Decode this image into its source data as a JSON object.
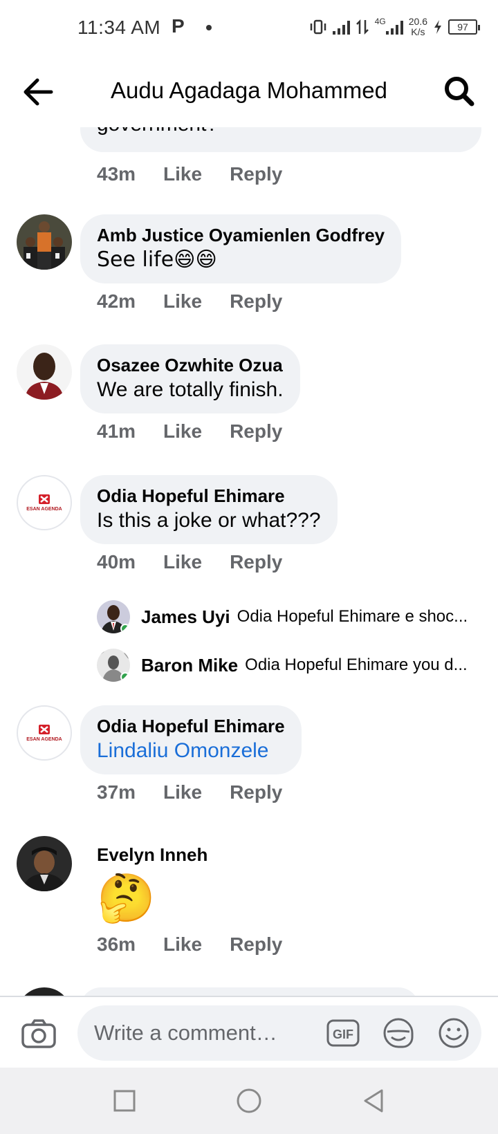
{
  "status_bar": {
    "time": "11:34 AM",
    "app_indicator": "P",
    "network_type": "4G",
    "net_speed_value": "20.6",
    "net_speed_unit": "K/s",
    "battery": "97"
  },
  "header": {
    "title": "Audu Agadaga Mohammed",
    "back_icon": "arrow-left-icon",
    "search_icon": "search-icon"
  },
  "comments": [
    {
      "text": "government?",
      "time": "43m",
      "like_label": "Like",
      "reply_label": "Reply"
    },
    {
      "author": "Amb Justice Oyamienlen Godfrey",
      "text": "See life😄😄",
      "time": "42m",
      "like_label": "Like",
      "reply_label": "Reply"
    },
    {
      "author": "Osazee Ozwhite Ozua",
      "text": "We are totally finish.",
      "time": "41m",
      "like_label": "Like",
      "reply_label": "Reply"
    },
    {
      "author": "Odia Hopeful Ehimare",
      "avatar_text": "ESAN AGENDA",
      "text": "Is this a joke or what???",
      "time": "40m",
      "like_label": "Like",
      "reply_label": "Reply",
      "replies": [
        {
          "author": "James Uyi",
          "text": "Odia Hopeful Ehimare e shoc..."
        },
        {
          "author": "Baron Mike",
          "text": "Odia Hopeful Ehimare you d..."
        }
      ]
    },
    {
      "author": "Odia Hopeful Ehimare",
      "avatar_text": "ESAN AGENDA",
      "text": "Lindaliu Omonzele",
      "time": "37m",
      "like_label": "Like",
      "reply_label": "Reply"
    },
    {
      "author": "Evelyn Inneh",
      "text": "🤔",
      "time": "36m",
      "like_label": "Like",
      "reply_label": "Reply"
    }
  ],
  "composer": {
    "placeholder": "Write a comment…",
    "gif_label": "GIF"
  },
  "colors": {
    "bubble_bg": "#f0f2f5",
    "meta_text": "#65676b",
    "link": "#1a6ed8",
    "online": "#31a24c"
  }
}
